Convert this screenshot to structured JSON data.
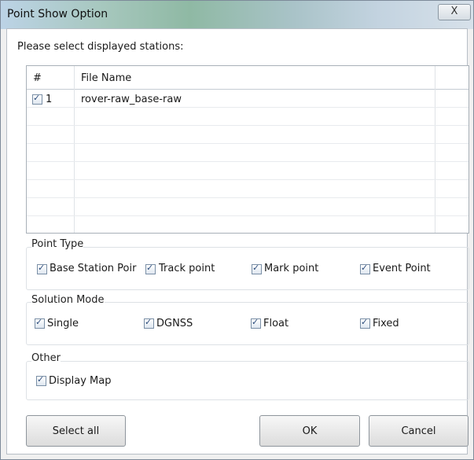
{
  "window": {
    "title": "Point Show Option",
    "close_glyph": "X"
  },
  "prompt": "Please select displayed stations:",
  "table": {
    "columns": [
      "#",
      "File Name"
    ],
    "rows": [
      {
        "checked": true,
        "index": "1",
        "file_name": "rover-raw_base-raw"
      }
    ]
  },
  "point_type": {
    "label": "Point Type",
    "options": [
      {
        "label": "Base Station Poir",
        "checked": true
      },
      {
        "label": "Track point",
        "checked": true
      },
      {
        "label": "Mark point",
        "checked": true
      },
      {
        "label": "Event Point",
        "checked": true
      }
    ]
  },
  "solution_mode": {
    "label": "Solution Mode",
    "options": [
      {
        "label": "Single",
        "checked": true
      },
      {
        "label": "DGNSS",
        "checked": true
      },
      {
        "label": "Float",
        "checked": true
      },
      {
        "label": "Fixed",
        "checked": true
      }
    ]
  },
  "other": {
    "label": "Other",
    "options": [
      {
        "label": "Display Map",
        "checked": true
      }
    ]
  },
  "buttons": {
    "select_all": "Select all",
    "ok": "OK",
    "cancel": "Cancel"
  }
}
